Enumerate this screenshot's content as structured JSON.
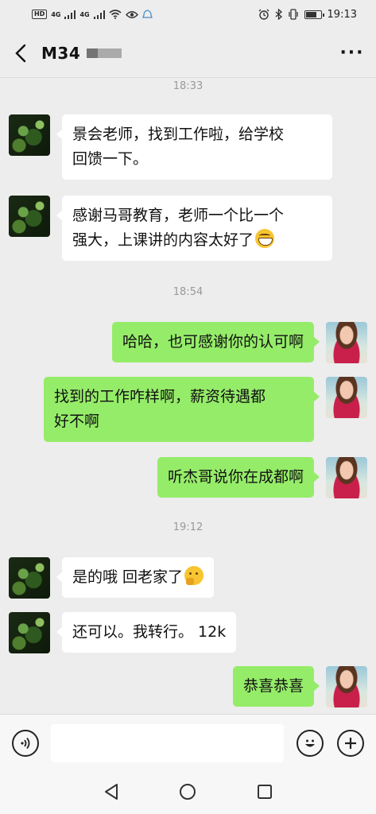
{
  "status_bar": {
    "hd_label": "HD",
    "signal_1": "4G",
    "signal_2": "4G",
    "time": "19:13"
  },
  "header": {
    "title": "M34",
    "back_icon": "chevron-left-icon",
    "more_label": "···"
  },
  "messages": [
    {
      "type": "time",
      "text": "18:33"
    },
    {
      "type": "recv",
      "lines": [
        "景会老师，找到工作啦，给学校",
        "回馈一下。"
      ]
    },
    {
      "type": "recv",
      "lines": [
        "感谢马哥教育，老师一个比一个",
        "强大，上课讲的内容太好了"
      ],
      "emoji": "grinning-face-icon"
    },
    {
      "type": "time",
      "text": "18:54"
    },
    {
      "type": "sent",
      "lines": [
        "哈哈，也可感谢你的认可啊"
      ]
    },
    {
      "type": "sent",
      "lines": [
        "找到的工作咋样啊，薪资待遇都",
        "好不啊"
      ]
    },
    {
      "type": "sent",
      "lines": [
        "听杰哥说你在成都啊"
      ]
    },
    {
      "type": "time",
      "text": "19:12"
    },
    {
      "type": "recv",
      "lines": [
        "是的哦 回老家了"
      ],
      "emoji": "thinking-face-icon"
    },
    {
      "type": "recv",
      "lines": [
        "还可以。我转行。 12k"
      ]
    },
    {
      "type": "sent",
      "lines": [
        "恭喜恭喜"
      ]
    }
  ],
  "input_bar": {
    "voice_icon": "voice-icon",
    "emoji_icon": "emoji-smile-icon",
    "plus_icon": "plus-icon",
    "input_value": ""
  },
  "nav_bar": {
    "back_icon": "triangle-back-icon",
    "home_icon": "circle-home-icon",
    "recent_icon": "square-recent-icon"
  }
}
